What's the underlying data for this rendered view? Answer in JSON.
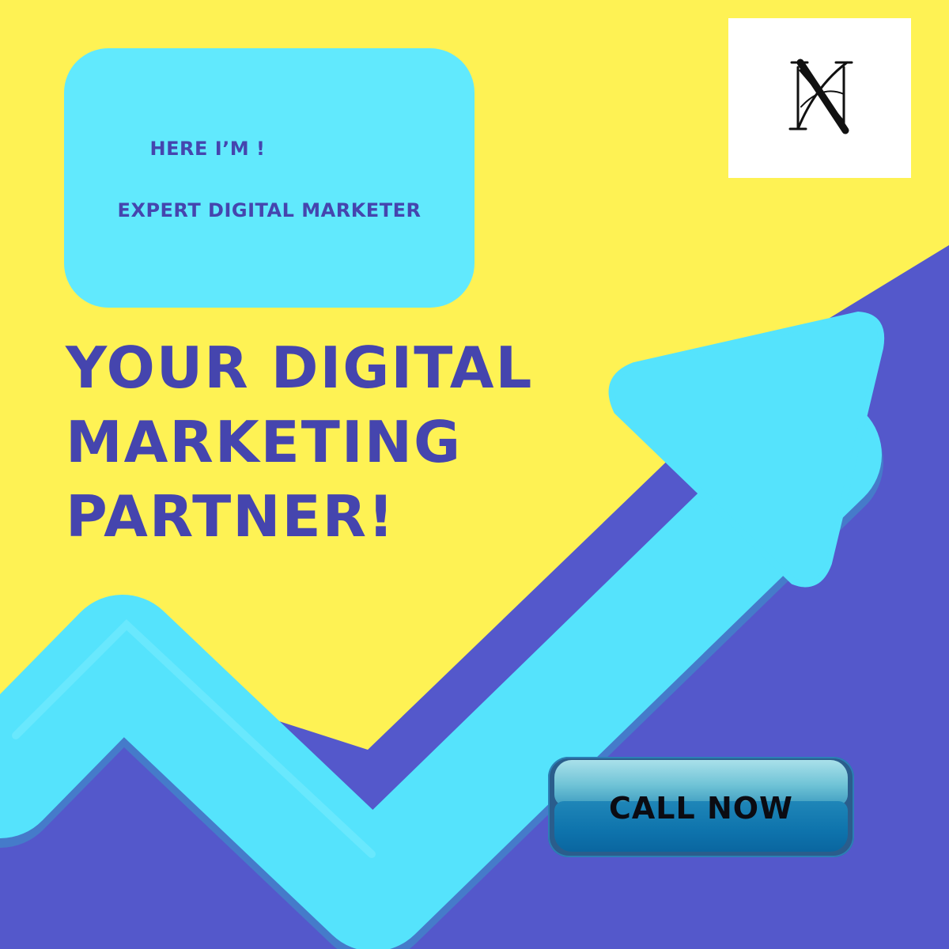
{
  "colors": {
    "background_yellow": "#FEF254",
    "background_purple": "#5458CB",
    "arrow_cyan": "#55E3FC",
    "card_cyan": "#61E9FD",
    "text_indigo": "#4545AE",
    "button_blue": "#0E73AC",
    "logo_background": "#FFFFFF"
  },
  "decoration": {
    "arrow_icon": "trend-up-arrow-icon"
  },
  "intro_card": {
    "line1": "HERE I’M !",
    "line2": "EXPERT DIGITAL MARKETER"
  },
  "headline": {
    "line1": "YOUR DIGITAL",
    "line2": "MARKETING",
    "line3": "PARTNER!"
  },
  "logo": {
    "monogram": "NN"
  },
  "cta": {
    "label": "CALL NOW"
  }
}
